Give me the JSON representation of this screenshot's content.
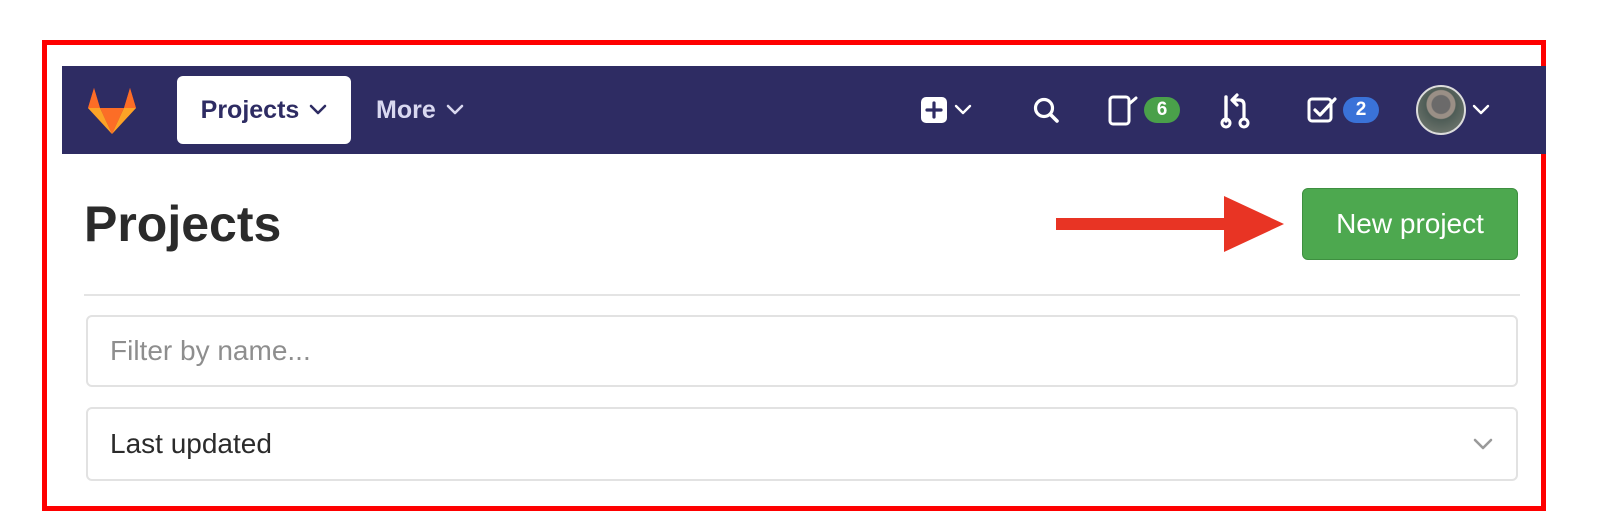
{
  "navbar": {
    "projects_label": "Projects",
    "more_label": "More",
    "issues_count": "6",
    "todos_count": "2"
  },
  "page": {
    "title": "Projects",
    "new_project_label": "New project"
  },
  "filter": {
    "placeholder": "Filter by name...",
    "value": ""
  },
  "sort": {
    "selected": "Last updated"
  },
  "colors": {
    "navbar_bg": "#2e2c63",
    "primary_button": "#4da84f",
    "annotation": "#fe0000",
    "issues_badge": "#4aa04a",
    "todos_badge": "#3a72d8"
  },
  "icons": [
    "gitlab-logo",
    "chevron-down-icon",
    "plus-square-icon",
    "search-icon",
    "issues-icon",
    "merge-request-icon",
    "todo-check-icon",
    "avatar",
    "arrow-right-annotation"
  ]
}
